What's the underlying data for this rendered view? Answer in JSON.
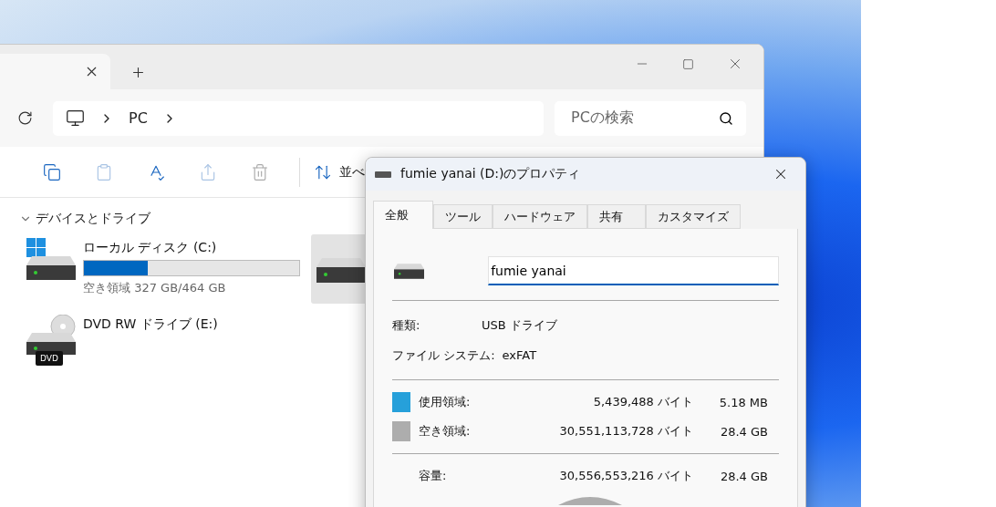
{
  "explorer": {
    "address": {
      "segments": [
        "PC"
      ]
    },
    "search": {
      "placeholder": "PCの検索"
    },
    "toolbar": {
      "sort_label": "並べ"
    },
    "section": {
      "title": "デバイスとドライブ",
      "expanded": true
    },
    "drives": [
      {
        "kind": "system",
        "name": "ローカル ディスク (C:)",
        "level": 0.295,
        "free": "空き領域 327 GB/464 GB",
        "selected": false
      },
      {
        "kind": "disk",
        "selected": true
      },
      {
        "kind": "dvd",
        "name": "DVD RW ドライブ (E:)",
        "badge": "DVD",
        "selected": false
      }
    ]
  },
  "dialog": {
    "title": "fumie yanai (D:)のプロパティ",
    "tabs": [
      {
        "label": "全般",
        "selected": true
      },
      {
        "label": "ツール",
        "selected": false
      },
      {
        "label": "ハードウェア",
        "selected": false
      },
      {
        "label": "共有",
        "selected": false
      },
      {
        "label": "カスタマイズ",
        "selected": false
      }
    ],
    "name_field": {
      "value": "fumie yanai"
    },
    "info": [
      {
        "label": "種類:",
        "value": "USB ドライブ"
      },
      {
        "label": "ファイル システム:",
        "value": "exFAT"
      }
    ],
    "usage": [
      {
        "label": "使用領域:",
        "color": "#26a0da",
        "bytes": "5,439,488 バイト",
        "size": "5.18 MB"
      },
      {
        "label": "空き領域:",
        "color": "#adadad",
        "bytes": "30,551,113,728 バイト",
        "size": "28.4 GB"
      }
    ],
    "capacity": {
      "label": "容量:",
      "bytes": "30,556,553,216 バイト",
      "size": "28.4 GB"
    }
  }
}
